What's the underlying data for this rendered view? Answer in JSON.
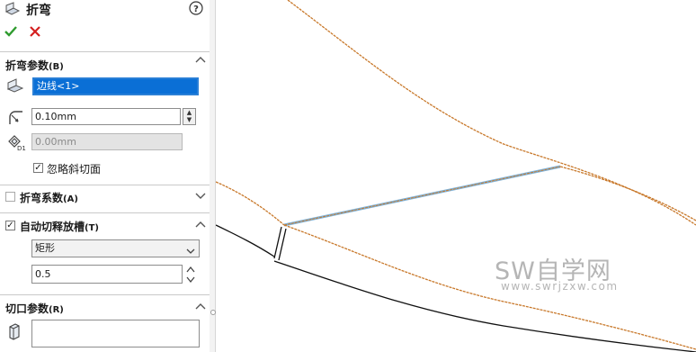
{
  "header": {
    "title": "折弯",
    "help_icon": "help-icon",
    "ok_icon": "check-icon",
    "cancel_icon": "close-icon",
    "ok_color": "#2e9b2e",
    "cancel_color": "#d42020"
  },
  "bend_params": {
    "title": "折弯参数",
    "shortcut": "(B)",
    "edge_selection": "边线<1>",
    "radius_value": "0.10mm",
    "thickness_value": "0.00mm",
    "ignore_bevel_label": "忽略斜切面",
    "ignore_bevel_checked": true,
    "selection_color": "#0a6fd6"
  },
  "bend_allowance": {
    "title": "折弯系数",
    "shortcut": "(A)",
    "checked": false
  },
  "auto_relief": {
    "title": "自动切释放槽",
    "shortcut": "(T)",
    "checked": true,
    "relief_type": "矩形",
    "ratio_value": "0.5"
  },
  "cut_params": {
    "title": "切口参数",
    "shortcut": "(R)",
    "selection": ""
  },
  "watermark": {
    "main": "SW自学网",
    "url": "www.swrjzxw.com"
  },
  "colors": {
    "edge_orange": "#c8782a",
    "edge_highlight": "#7fb2d8"
  }
}
